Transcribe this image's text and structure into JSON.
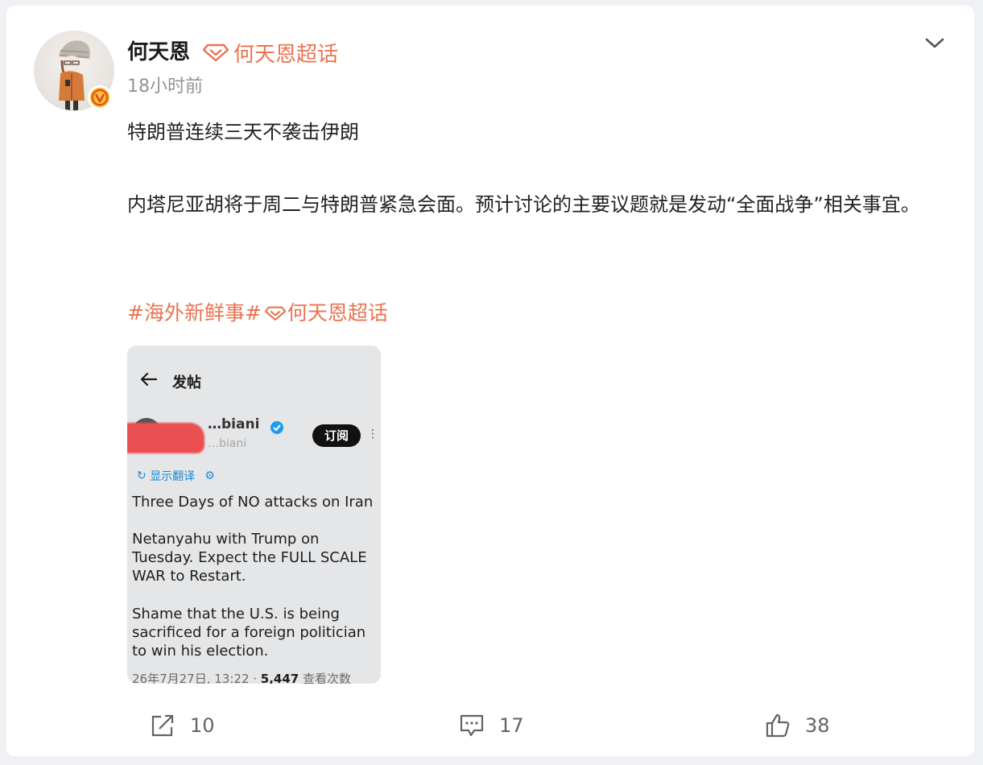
{
  "post": {
    "author": "何天恩",
    "super_topic": "何天恩超话",
    "time": "18小时前",
    "text_line1": "特朗普连续三天不袭击伊朗",
    "text_para2": "内塔尼亚胡将于周二与特朗普紧急会面。预计讨论的主要议题就是发动“全面战争”相关事宜。",
    "hashtag1": "#海外新鲜事#",
    "hashtag2": "何天恩超话",
    "accent_color": "#eb7350"
  },
  "embedded_screenshot": {
    "title": "发帖",
    "user_name_visible": "…biani",
    "user_handle_visible": "…biani",
    "subscribe_label": "订阅",
    "translate_label": "显示翻译",
    "para1": "Three Days of NO attacks on Iran",
    "para2": "Netanyahu with Trump on Tuesday. Expect the FULL SCALE WAR to Restart.",
    "para3": "Shame that the U.S. is being sacrificed for a foreign politician to win his election.",
    "meta_date": "26年7月27日, 13:22 · ",
    "meta_views": "5,447",
    "meta_views_label": " 查看次数"
  },
  "actions": {
    "repost_count": "10",
    "comment_count": "17",
    "like_count": "38"
  },
  "icons": {
    "more": "chevron-down-icon",
    "repost": "share-icon",
    "comment": "comment-icon",
    "like": "thumbs-up-icon",
    "super_topic": "diamond-icon",
    "verified": "v-badge-icon"
  }
}
